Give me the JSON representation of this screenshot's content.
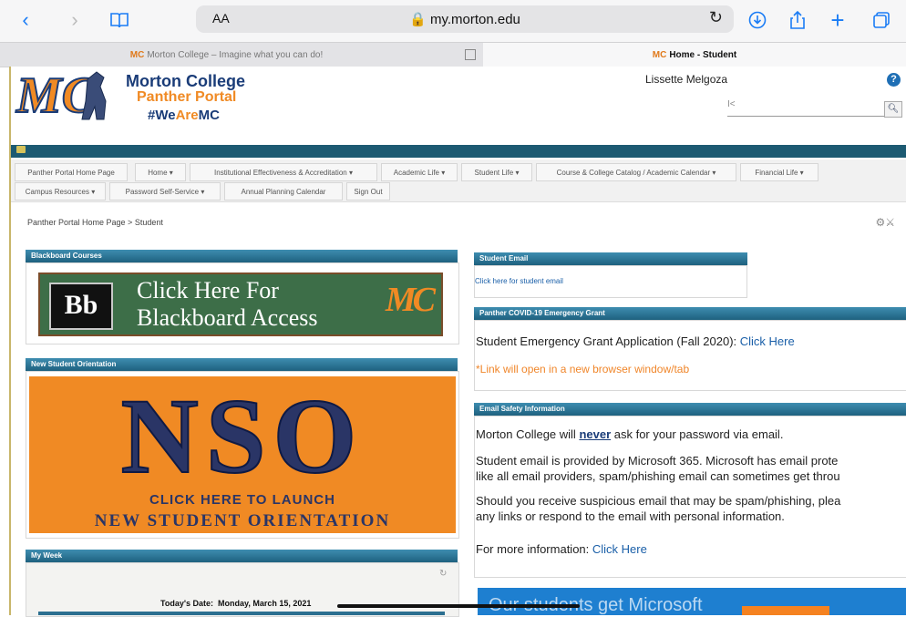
{
  "browser": {
    "aa_label": "AA",
    "url": "my.morton.edu",
    "tabs": [
      {
        "label": "Morton College – Imagine what you can do!"
      },
      {
        "label": "Home - Student"
      }
    ]
  },
  "header": {
    "brand_line1": "Morton College",
    "brand_line2": "Panther Portal",
    "brand_line3_a": "#We",
    "brand_line3_b": "Are",
    "brand_line3_c": "MC",
    "user_name": "Lissette Melgoza",
    "help": "?",
    "search_value": "I<"
  },
  "nav": {
    "row1": [
      "Panther Portal Home Page",
      "Home ▾",
      "Institutional Effectiveness & Accreditation ▾",
      "Academic Life ▾",
      "Student Life ▾",
      "Course & College Catalog / Academic Calendar ▾",
      "Financial Life ▾"
    ],
    "row2": [
      "Campus Resources ▾",
      "Password Self-Service ▾",
      "Annual Planning Calendar",
      "Sign Out"
    ]
  },
  "breadcrumb": "Panther Portal Home Page >  Student",
  "left": {
    "blackboard": {
      "title": "Blackboard Courses",
      "logo": "Bb",
      "line1": "Click Here For",
      "line2": "Blackboard Access",
      "mc": "MC"
    },
    "nso": {
      "title": "New Student Orientation",
      "big": "NSO",
      "line1": "CLICK HERE TO LAUNCH",
      "line2": "NEW STUDENT ORIENTATION"
    },
    "myweek": {
      "title": "My Week",
      "today_label": "Today's Date:",
      "today_value": "Monday, March 15, 2021"
    }
  },
  "right": {
    "email": {
      "title": "Student Email",
      "link": "Click here for student email"
    },
    "covid": {
      "title": "Panther COVID-19 Emergency Grant",
      "text": "Student Emergency Grant Application (Fall 2020): ",
      "link": "Click Here",
      "note": "*Link will open in a new browser window/tab"
    },
    "safety": {
      "title": "Email Safety Information",
      "p1a": "Morton College will ",
      "p1b": "never",
      "p1c": " ask for your password via email.",
      "p2a": "Student email is provided by Microsoft 365. Microsoft has email prote",
      "p2b": "like all email providers, spam/phishing email can sometimes get throu",
      "p3a": "Should you receive suspicious email that may be spam/phishing, plea",
      "p3b": "any links or respond to the email with personal information.",
      "p4": "For more information: ",
      "p4link": "Click Here"
    },
    "ms_banner": "Our students get Microsoft"
  }
}
